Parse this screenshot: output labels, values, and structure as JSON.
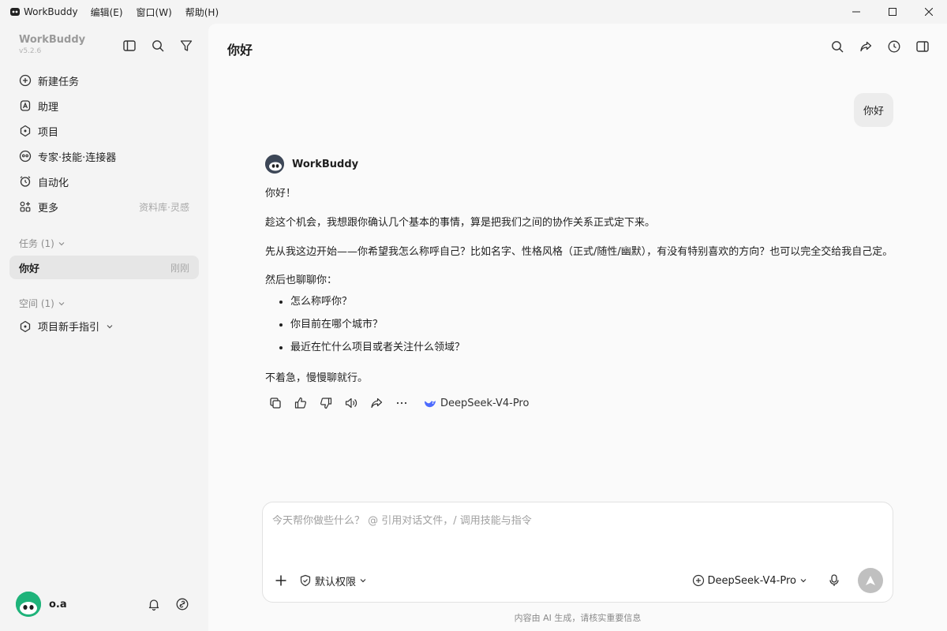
{
  "titlebar": {
    "app_name": "WorkBuddy",
    "menus": [
      "编辑(E)",
      "窗口(W)",
      "帮助(H)"
    ]
  },
  "sidebar": {
    "brand": "WorkBuddy",
    "version": "v5.2.6",
    "nav": [
      {
        "label": "新建任务",
        "icon": "plus-circle-icon"
      },
      {
        "label": "助理",
        "icon": "assistant-icon"
      },
      {
        "label": "项目",
        "icon": "project-icon"
      },
      {
        "label": "专家·技能·连接器",
        "icon": "expert-icon"
      },
      {
        "label": "自动化",
        "icon": "alarm-clock-icon"
      },
      {
        "label": "更多",
        "icon": "grid-plus-icon",
        "extra": "资料库·灵感"
      }
    ],
    "tasks_header": "任务 (1)",
    "task": {
      "label": "你好",
      "time": "刚刚"
    },
    "space_header": "空间 (1)",
    "space_item": "项目新手指引",
    "user": {
      "name": "o.a"
    }
  },
  "main": {
    "title": "你好",
    "user_message": "你好",
    "bot": {
      "name": "WorkBuddy",
      "greeting": "你好！",
      "para1": "趁这个机会，我想跟你确认几个基本的事情，算是把我们之间的协作关系正式定下来。",
      "para2": "先从我这边开始——你希望我怎么称呼自己？比如名字、性格风格（正式/随性/幽默），有没有特别喜欢的方向？也可以完全交给我自己定。",
      "para3": "然后也聊聊你：",
      "bullets": [
        "怎么称呼你？",
        "你目前在哪个城市？",
        "最近在忙什么项目或者关注什么领域？"
      ],
      "closing": "不着急，慢慢聊就行。",
      "model": "DeepSeek-V4-Pro"
    },
    "composer": {
      "placeholder": "今天帮你做些什么？ @ 引用对话文件，/ 调用技能与指令",
      "permission": "默认权限",
      "model": "DeepSeek-V4-Pro"
    },
    "footer": "内容由 AI 生成，请核实重要信息"
  },
  "colors": {
    "sidebar_bg": "#f4f4f4",
    "main_bg": "#fafafa",
    "selected_bg": "#e6e6e6",
    "avatar_green": "#1fb37a",
    "deepseek_blue": "#4d6bfe"
  }
}
